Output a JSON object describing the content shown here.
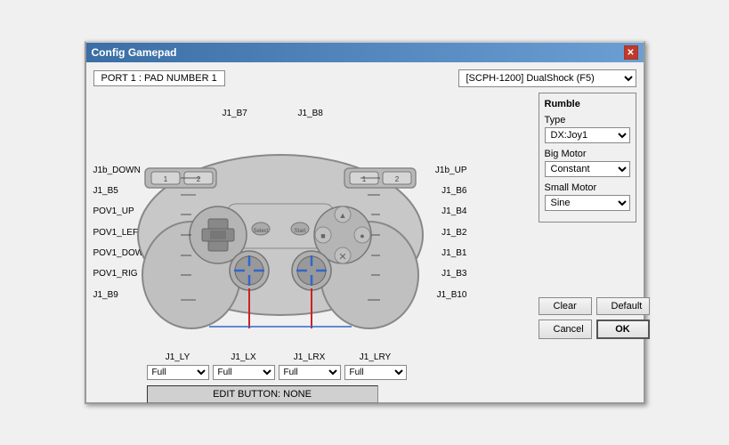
{
  "window": {
    "title": "Config Gamepad",
    "close_label": "✕"
  },
  "header": {
    "port_label": "PORT 1 : PAD NUMBER 1",
    "device_value": "[SCPH-1200] DualShock (F5)"
  },
  "rumble": {
    "section_title": "Rumble",
    "type_label": "Type",
    "type_value": "DX:Joy1",
    "big_motor_label": "Big Motor",
    "big_motor_value": "Constant",
    "small_motor_label": "Small Motor",
    "small_motor_value": "Sine"
  },
  "axis_labels": [
    "J1_LY",
    "J1_LX",
    "J1_LRX",
    "J1_LRY"
  ],
  "axis_dropdowns": [
    "Full",
    "Full",
    "Full",
    "Full"
  ],
  "button_labels_left": [
    "J1b_DOWN",
    "J1_B5",
    "POV1_UP",
    "POV1_LEF",
    "POV1_DOW",
    "POV1_RIG",
    "J1_B9"
  ],
  "button_labels_right": [
    "J1b_UP",
    "J1_B6",
    "J1_B4",
    "J1_B2",
    "J1_B1",
    "J1_B3",
    "J1_B10"
  ],
  "button_labels_top": [
    "J1_B7",
    "J1_B8"
  ],
  "edit_button_text": "EDIT BUTTON: NONE",
  "buttons": {
    "clear": "Clear",
    "default": "Default",
    "cancel": "Cancel",
    "ok": "OK"
  }
}
